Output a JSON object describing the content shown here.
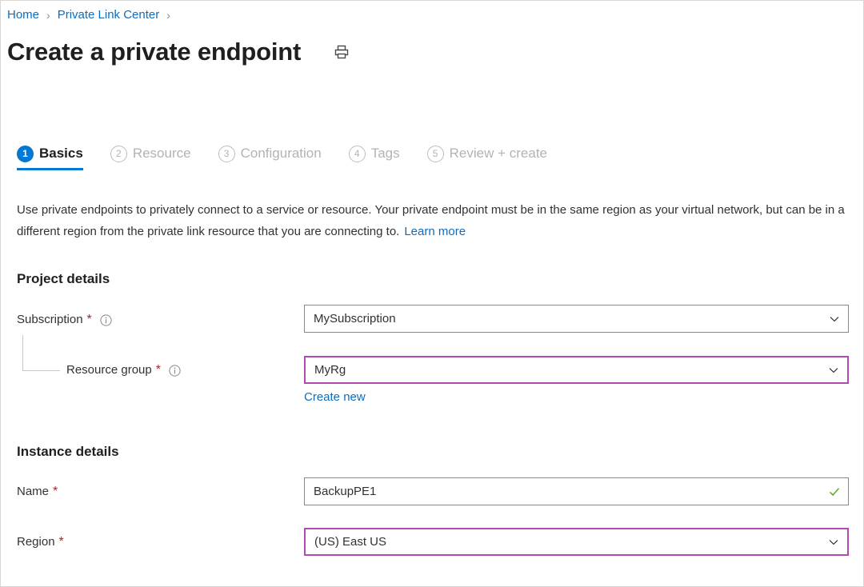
{
  "breadcrumb": {
    "items": [
      {
        "label": "Home"
      },
      {
        "label": "Private Link Center"
      }
    ],
    "separator": "›"
  },
  "header": {
    "title": "Create a private endpoint",
    "print_icon": "print-icon"
  },
  "tabs": [
    {
      "num": "1",
      "label": "Basics",
      "active": true
    },
    {
      "num": "2",
      "label": "Resource",
      "active": false
    },
    {
      "num": "3",
      "label": "Configuration",
      "active": false
    },
    {
      "num": "4",
      "label": "Tags",
      "active": false
    },
    {
      "num": "5",
      "label": "Review + create",
      "active": false
    }
  ],
  "description": {
    "text": "Use private endpoints to privately connect to a service or resource. Your private endpoint must be in the same region as your virtual network, but can be in a different region from the private link resource that you are connecting to.",
    "link_label": "Learn more"
  },
  "sections": {
    "project_details": {
      "heading": "Project details",
      "fields": {
        "subscription": {
          "label": "Subscription",
          "required_marker": "*",
          "info_icon": "info-icon",
          "value": "MySubscription",
          "chevron_icon": "chevron-down-icon",
          "highlighted": false
        },
        "resource_group": {
          "label": "Resource group",
          "required_marker": "*",
          "info_icon": "info-icon",
          "value": "MyRg",
          "chevron_icon": "chevron-down-icon",
          "highlighted": true,
          "create_new_label": "Create new"
        }
      }
    },
    "instance_details": {
      "heading": "Instance details",
      "fields": {
        "name": {
          "label": "Name",
          "required_marker": "*",
          "value": "BackupPE1",
          "validation_icon": "checkmark-icon",
          "highlighted": false
        },
        "region": {
          "label": "Region",
          "required_marker": "*",
          "value": "(US) East US",
          "chevron_icon": "chevron-down-icon",
          "highlighted": true
        }
      }
    }
  },
  "colors": {
    "link": "#0f6cbd",
    "accent": "#0078d4",
    "required": "#a4262c",
    "highlight_border": "#b14ab1",
    "valid_check": "#5fae2e",
    "inactive_tab": "#b3b3b3"
  }
}
